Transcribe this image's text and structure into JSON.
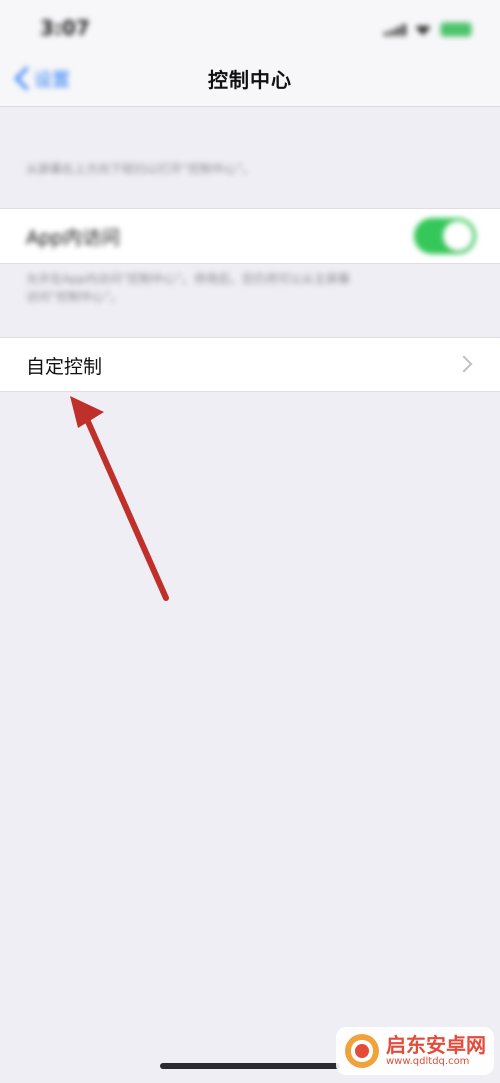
{
  "status_bar": {
    "time": "3:07"
  },
  "nav": {
    "back_label": "设置",
    "title": "控制中心"
  },
  "section1": {
    "note": "从屏幕右上方向下轻扫以打开“控制中心”。"
  },
  "app_access": {
    "label": "App内访问",
    "toggle_on": true,
    "note_line1": "允许在App内访问“控制中心”。停用后，您仍然可以从主屏幕",
    "note_line2": "访问“控制中心”。"
  },
  "customize": {
    "label": "自定控制"
  },
  "colors": {
    "accent": "#2a7bf6",
    "toggle": "#34c759",
    "arrow": "#c0302a"
  },
  "watermark": {
    "title": "启东安卓网",
    "url": "www.qdltdq.com"
  }
}
